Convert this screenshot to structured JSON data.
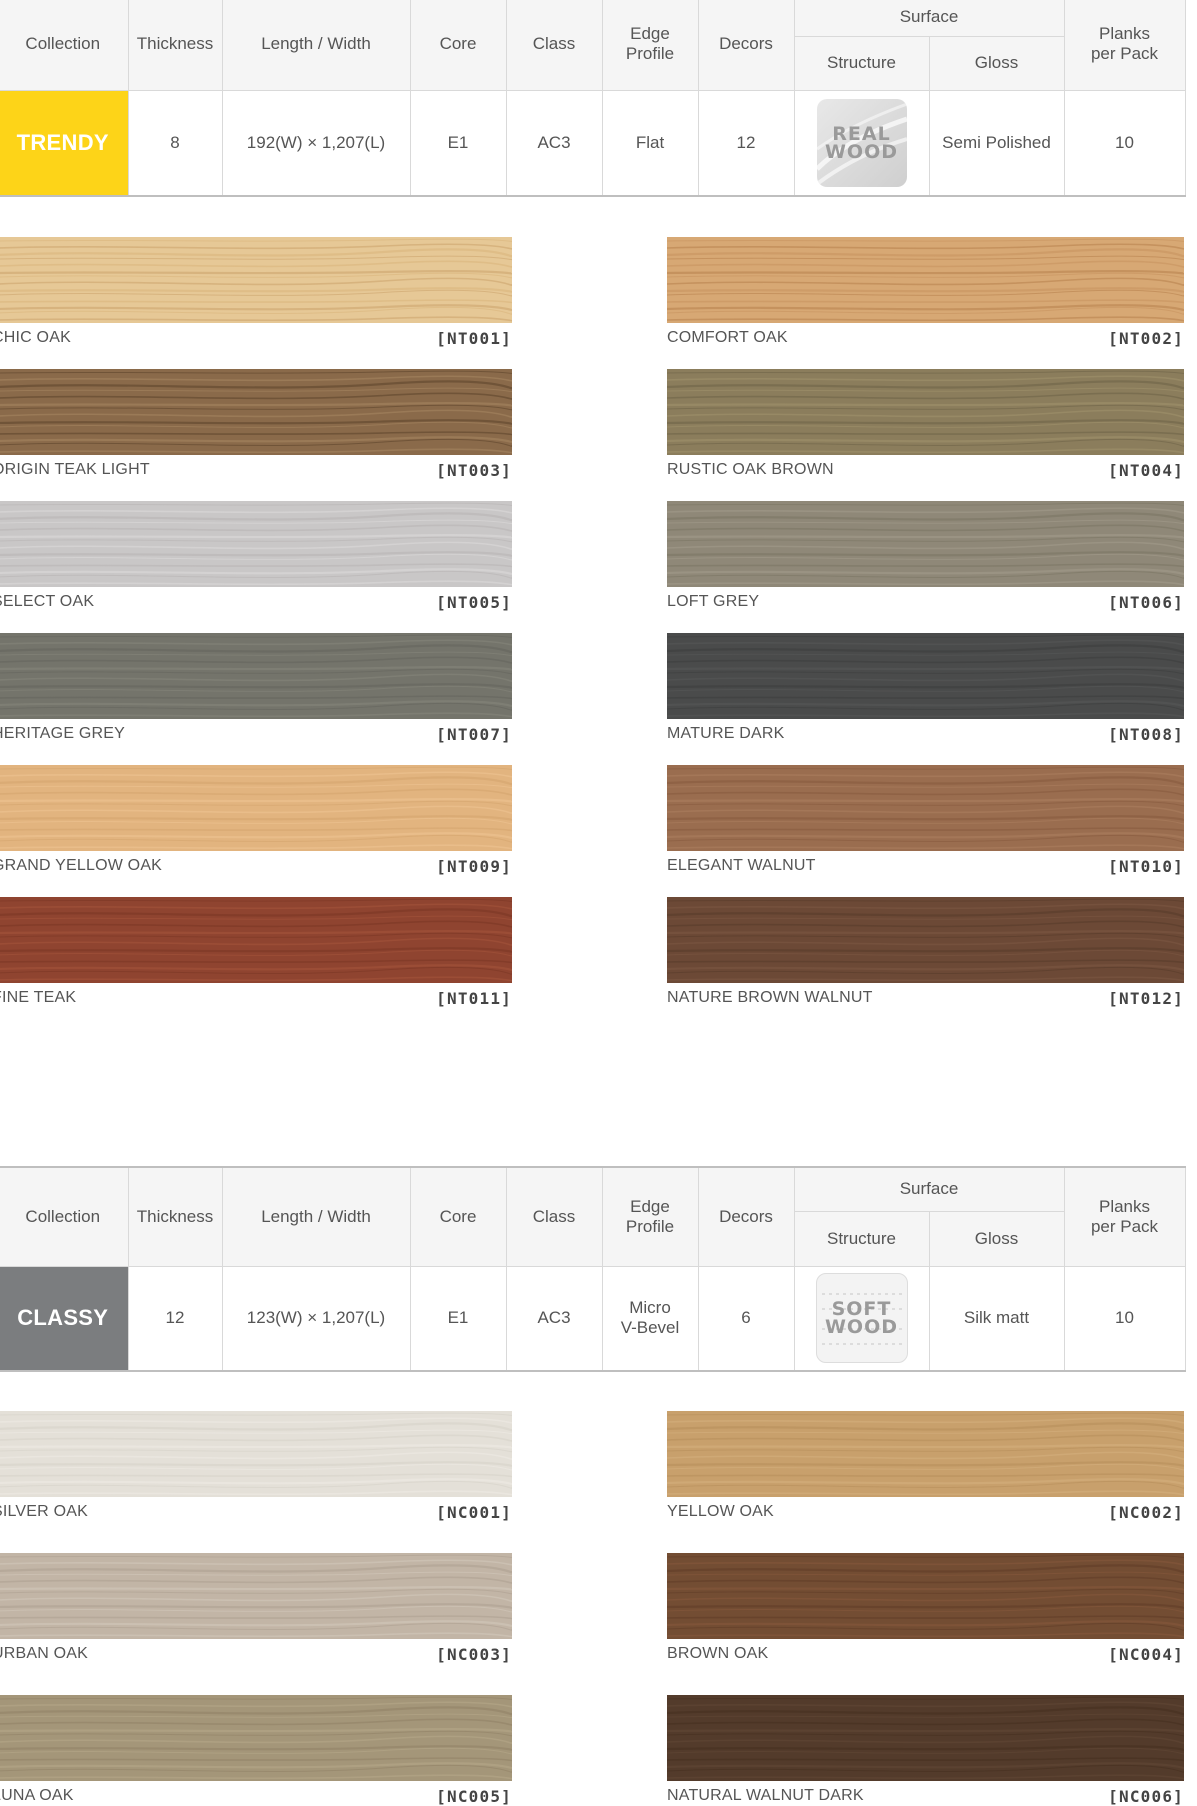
{
  "headers": {
    "collection": "Collection",
    "thickness": "Thickness",
    "length_width": "Length / Width",
    "core": "Core",
    "class": "Class",
    "edge_profile_1": "Edge",
    "edge_profile_2": "Profile",
    "decors": "Decors",
    "surface": "Surface",
    "structure": "Structure",
    "gloss": "Gloss",
    "planks_1": "Planks",
    "planks_2": "per Pack"
  },
  "trendy": {
    "name": "TRENDY",
    "badge_color": "#FDD418",
    "thickness": "8",
    "length_width": "192(W) × 1,207(L)",
    "core": "E1",
    "class": "AC3",
    "edge_profile": "Flat",
    "decors": "12",
    "structure_line1": "REAL",
    "structure_line2": "WOOD",
    "structure_icon": "real-wood-tile",
    "gloss": "Semi Polished",
    "planks_per_pack": "10",
    "decor_list": [
      {
        "name": "CHIC OAK",
        "code": "[NT001]",
        "colors": [
          "#e6c896",
          "#d9b47c",
          "#caa26b"
        ]
      },
      {
        "name": "COMFORT OAK",
        "code": "[NT002]",
        "colors": [
          "#d7a874",
          "#c6925e",
          "#b67f4d"
        ]
      },
      {
        "name": "ORIGIN TEAK LIGHT",
        "code": "[NT003]",
        "colors": [
          "#8a6a4a",
          "#5b4129",
          "#a78663"
        ]
      },
      {
        "name": "RUSTIC OAK BROWN",
        "code": "[NT004]",
        "colors": [
          "#8b7d5c",
          "#6e6247",
          "#a2936d"
        ]
      },
      {
        "name": "SELECT OAK",
        "code": "[NT005]",
        "colors": [
          "#c9c7c7",
          "#b6b3b3",
          "#dcdada"
        ]
      },
      {
        "name": "LOFT GREY",
        "code": "[NT006]",
        "colors": [
          "#8f8878",
          "#7a7463",
          "#a49d8c"
        ]
      },
      {
        "name": "HERITAGE GREY",
        "code": "[NT007]",
        "colors": [
          "#74746b",
          "#65655c",
          "#86867c"
        ]
      },
      {
        "name": "MATURE DARK",
        "code": "[NT008]",
        "colors": [
          "#4a4b4b",
          "#3d3e3e",
          "#585959"
        ]
      },
      {
        "name": "GRAND YELLOW OAK",
        "code": "[NT009]",
        "colors": [
          "#e2b47f",
          "#d4a46e",
          "#eec593"
        ]
      },
      {
        "name": "ELEGANT WALNUT",
        "code": "[NT010]",
        "colors": [
          "#9a6d4f",
          "#86593e",
          "#ad8060"
        ]
      },
      {
        "name": "FINE TEAK",
        "code": "[NT011]",
        "colors": [
          "#8f4430",
          "#7a3624",
          "#a5553c"
        ]
      },
      {
        "name": "NATURE BROWN WALNUT",
        "code": "[NT012]",
        "colors": [
          "#6c4936",
          "#583a2a",
          "#7e5843"
        ]
      }
    ]
  },
  "classy": {
    "name": "CLASSY",
    "badge_color": "#7B7D7F",
    "thickness": "12",
    "length_width": "123(W) × 1,207(L)",
    "core": "E1",
    "class": "AC3",
    "edge_profile_1": "Micro",
    "edge_profile_2": "V-Bevel",
    "decors": "6",
    "structure_line1": "SOFT",
    "structure_line2": "WOOD",
    "structure_icon": "soft-wood-tile",
    "gloss": "Silk matt",
    "planks_per_pack": "10",
    "decor_list": [
      {
        "name": "SILVER OAK",
        "code": "[NC001]",
        "colors": [
          "#e4e0d8",
          "#d6d1c8",
          "#eeebe5"
        ]
      },
      {
        "name": "YELLOW OAK",
        "code": "[NC002]",
        "colors": [
          "#c8a06c",
          "#b78e5b",
          "#d6b080"
        ]
      },
      {
        "name": "URBAN OAK",
        "code": "[NC003]",
        "colors": [
          "#c2b5a6",
          "#ad9f8f",
          "#d3c8bb"
        ]
      },
      {
        "name": "BROWN OAK",
        "code": "[NC004]",
        "colors": [
          "#734d33",
          "#5f3d27",
          "#86593c"
        ]
      },
      {
        "name": "LUNA OAK",
        "code": "[NC005]",
        "colors": [
          "#a49679",
          "#8f8266",
          "#b7a98b"
        ]
      },
      {
        "name": "NATURAL WALNUT DARK",
        "code": "[NC006]",
        "colors": [
          "#533b2b",
          "#45301f",
          "#634837"
        ]
      }
    ]
  }
}
